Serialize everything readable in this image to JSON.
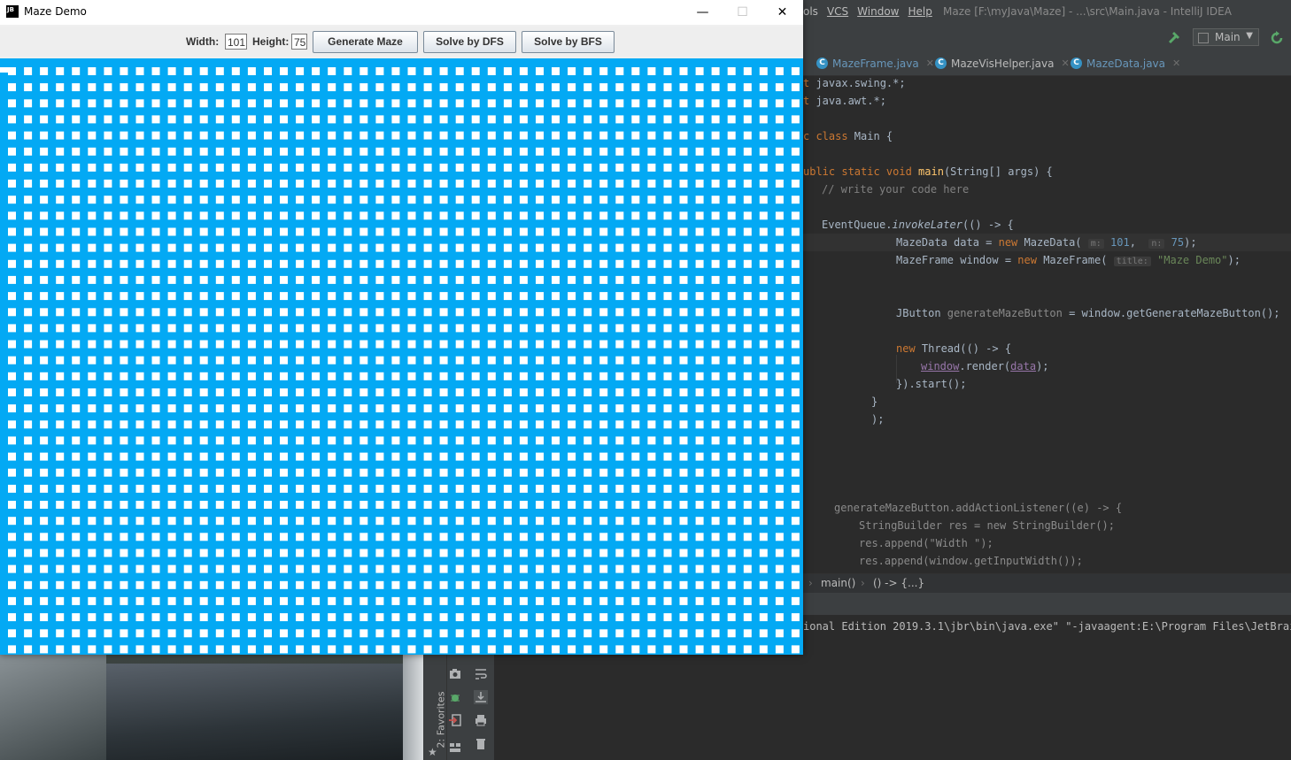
{
  "ide": {
    "menu": [
      "ols",
      "VCS",
      "Window",
      "Help"
    ],
    "window_title": "Maze [F:\\myJava\\Maze] - ...\\src\\Main.java - IntelliJ IDEA",
    "run_config": "Main",
    "tabs": [
      {
        "label": "MazeFrame.java"
      },
      {
        "label": "MazeVisHelper.java"
      },
      {
        "label": "MazeData.java"
      }
    ],
    "code": {
      "l1_kw": "t ",
      "l1": "javax.swing.*;",
      "l2_kw": "t ",
      "l2": "java.awt.*;",
      "l3_kw": "c class ",
      "l3": "Main {",
      "l4_kw": "ublic static void ",
      "l4_fn": "main",
      "l4": "(String[] args) {",
      "l5": "// write your code here",
      "l6_a": "EventQueue.",
      "l6_b": "invokeLater",
      "l6_c": "(() -> {",
      "l7_a": "MazeData data = ",
      "l7_kw": "new ",
      "l7_b": "MazeData( ",
      "l7_h1": "m:",
      "l7_n1": " 101",
      "l7_c": ",  ",
      "l7_h2": "n:",
      "l7_n2": " 75",
      "l7_d": ");",
      "l8_a": "MazeFrame window = ",
      "l8_kw": "new ",
      "l8_b": "MazeFrame( ",
      "l8_h": "title:",
      "l8_s": " \"Maze Demo\"",
      "l8_c": ");",
      "l9": "JButton ",
      "l9_g": "generateMazeButton",
      "l9_b": " = window.getGenerateMazeButton();",
      "l10_kw": "new ",
      "l10": "Thread(() -> {",
      "l11_a": "window",
      "l11_b": ".render(",
      "l11_c": "data",
      "l11_d": ");",
      "l12": "}).start();",
      "l13": "}",
      "l14": ");",
      "l15": "generateMazeButton.addActionListener((e) -> {",
      "l16": "StringBuilder res = new StringBuilder();",
      "l17": "res.append(\"Width \");",
      "l18": "res.append(window.getInputWidth());"
    },
    "breadcrumb": [
      "main()",
      "() -> {...}"
    ],
    "console_line": "ional Edition 2019.3.1\\jbr\\bin\\java.exe\" \"-javaagent:E:\\Program Files\\JetBrains",
    "favorites_label": "2: Favorites"
  },
  "window": {
    "title": "Maze Demo",
    "app_icon": "JB",
    "minimize_glyph": "—",
    "maximize_glyph": "☐",
    "close_glyph": "✕"
  },
  "toolbar": {
    "width_label": "Width:",
    "width_value": "101",
    "height_label": "Height:",
    "height_value": "75",
    "generate_label": "Generate Maze",
    "dfs_label": "Solve by DFS",
    "bfs_label": "Solve by BFS"
  },
  "maze": {
    "cols": 50,
    "rows": 37,
    "wall_color": "#03A9F4",
    "road_color": "#FFFFFF"
  }
}
